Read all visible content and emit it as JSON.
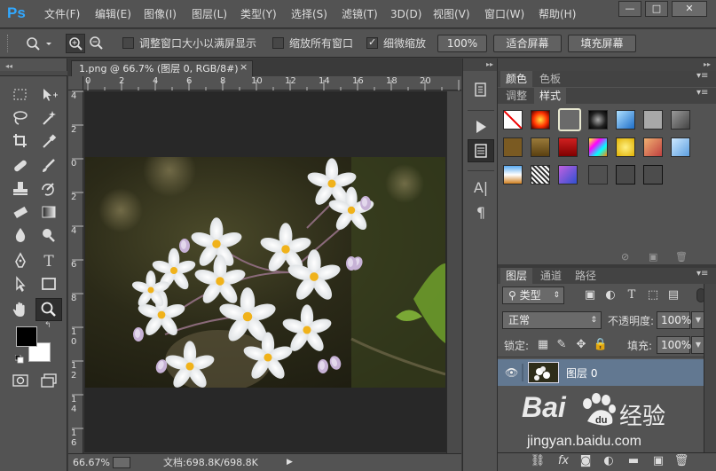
{
  "app": {
    "logo": "Ps"
  },
  "menu": [
    "文件(F)",
    "编辑(E)",
    "图像(I)",
    "图层(L)",
    "类型(Y)",
    "选择(S)",
    "滤镜(T)",
    "3D(D)",
    "视图(V)",
    "窗口(W)",
    "帮助(H)"
  ],
  "window_controls": {
    "minimize": "—",
    "restore": "□",
    "close": "✕"
  },
  "options": {
    "resize_windows_label": "调整窗口大小以满屏显示",
    "resize_windows_checked": false,
    "zoom_all_label": "缩放所有窗口",
    "zoom_all_checked": false,
    "scrubby_zoom_label": "细微缩放",
    "scrubby_zoom_checked": true,
    "btn_100": "100%",
    "btn_fit": "适合屏幕",
    "btn_fill": "填充屏幕"
  },
  "document": {
    "tab_title": "1.png @ 66.7% (图层 0, RGB/8#)",
    "tab_close": "×",
    "ruler_h": [
      "0",
      "2",
      "4",
      "6",
      "8",
      "10",
      "12",
      "14",
      "16",
      "18",
      "20"
    ],
    "ruler_v": [
      "4",
      "2",
      "0",
      "2",
      "4",
      "6",
      "8",
      "1",
      "0",
      "1",
      "2",
      "1",
      "4",
      "1",
      "6"
    ],
    "zoom": "66.67%",
    "doc_info": "文档:698.8K/698.8K"
  },
  "panels": {
    "tab_color": "颜色",
    "tab_swatches": "色板",
    "tab_adjust": "调整",
    "tab_styles": "样式",
    "tab_layers": "图层",
    "tab_channels": "通道",
    "tab_paths": "路径",
    "kind_filter": "类型",
    "blend_mode": "正常",
    "opacity_label": "不透明度:",
    "opacity_value": "100%",
    "lock_label": "锁定:",
    "fill_label": "填充:",
    "fill_value": "100%",
    "layer_name": "图层 0",
    "fx_label": "fx"
  },
  "watermark": {
    "brand": "Bai",
    "brand_suffix": "经验",
    "url": "jingyan.baidu.com"
  },
  "colors": {
    "ps_blue": "#31a8ff",
    "chrome": "#535353",
    "dark_bg": "#282828",
    "layer_selected": "#627891"
  }
}
